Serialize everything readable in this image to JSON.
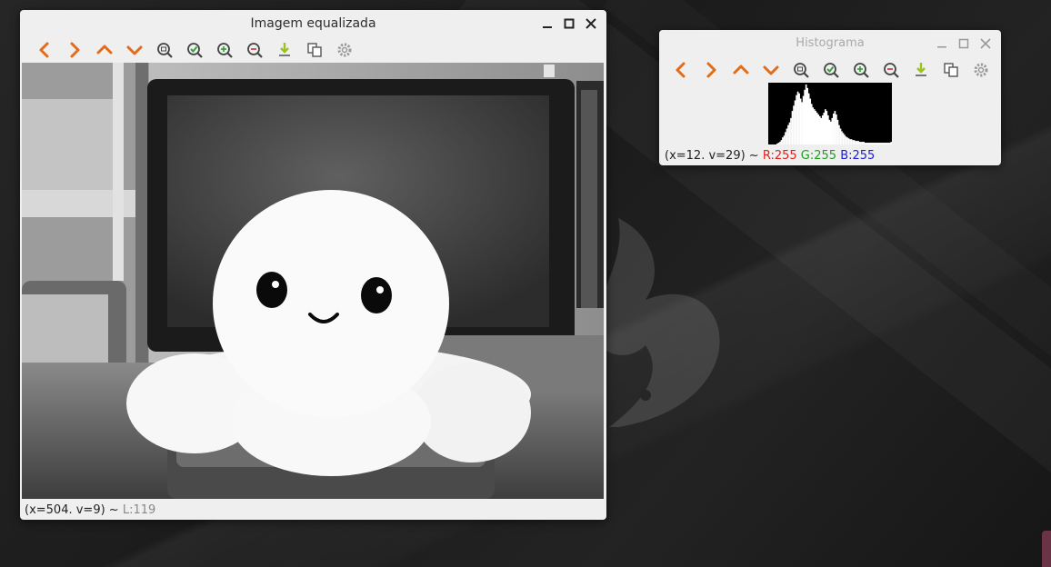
{
  "main_window": {
    "title": "Imagem equalizada",
    "status_coords": "(x=504. v=9) ~ ",
    "status_value": "L:119"
  },
  "hist_window": {
    "title": "Histograma",
    "status_coords": "(x=12. v=29) ~ ",
    "status_r": "R:255",
    "status_g": "G:255",
    "status_b": "B:255"
  },
  "toolbar_icons": [
    "arrow-left-icon",
    "arrow-right-icon",
    "arrow-up-icon",
    "arrow-down-icon",
    "zoom-fit-icon",
    "zoom-reset-icon",
    "zoom-in-icon",
    "zoom-out-icon",
    "save-icon",
    "copy-icon",
    "settings-icon"
  ],
  "colors": {
    "accent_orange": "#e06c1c",
    "check_green": "#3aa23a",
    "save_green": "#9bc21e",
    "window_bg": "#efefef"
  },
  "histogram": {
    "bins": [
      0,
      0,
      0,
      0,
      0,
      0,
      1,
      2,
      3,
      5,
      8,
      10,
      14,
      18,
      22,
      25,
      30,
      38,
      44,
      50,
      56,
      60,
      58,
      52,
      48,
      55,
      62,
      68,
      64,
      58,
      52,
      46,
      42,
      40,
      38,
      36,
      34,
      32,
      30,
      33,
      36,
      40,
      38,
      33,
      28,
      26,
      30,
      35,
      38,
      34,
      28,
      22,
      18,
      15,
      13,
      11,
      9,
      8,
      7,
      6,
      6,
      5,
      5,
      4,
      4,
      4,
      3,
      3,
      3,
      3,
      2,
      2,
      2,
      2,
      2,
      2,
      2,
      2,
      2,
      2,
      2,
      2,
      2,
      2,
      2,
      2,
      2,
      2,
      2,
      3
    ]
  }
}
